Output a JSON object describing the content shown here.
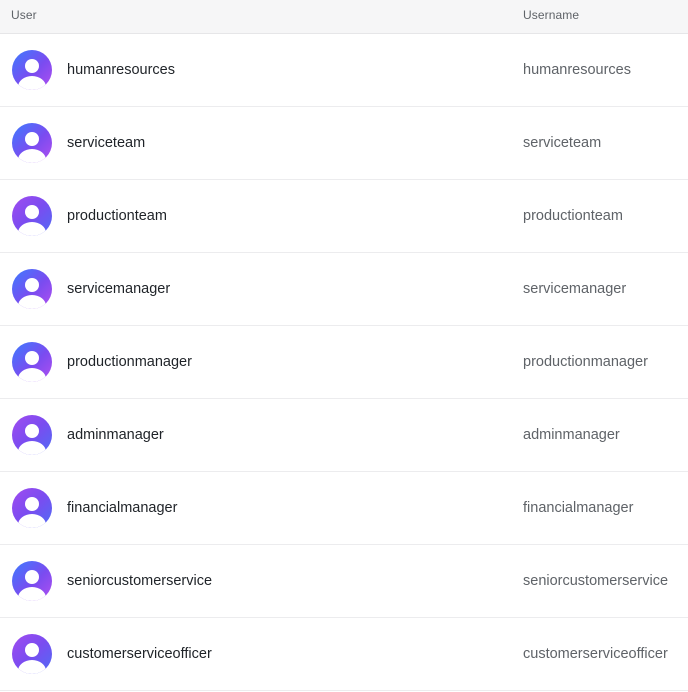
{
  "table": {
    "columns": {
      "user": "User",
      "username": "Username"
    },
    "rows": [
      {
        "name": "humanresources",
        "username": "humanresources",
        "avatar_icon": "user-avatar-icon"
      },
      {
        "name": "serviceteam",
        "username": "serviceteam",
        "avatar_icon": "user-avatar-icon"
      },
      {
        "name": "productionteam",
        "username": "productionteam",
        "avatar_icon": "user-avatar-icon"
      },
      {
        "name": "servicemanager",
        "username": "servicemanager",
        "avatar_icon": "user-avatar-icon"
      },
      {
        "name": "productionmanager",
        "username": "productionmanager",
        "avatar_icon": "user-avatar-icon"
      },
      {
        "name": "adminmanager",
        "username": "adminmanager",
        "avatar_icon": "user-avatar-icon"
      },
      {
        "name": "financialmanager",
        "username": "financialmanager",
        "avatar_icon": "user-avatar-icon"
      },
      {
        "name": "seniorcustomerservice",
        "username": "seniorcustomerservice",
        "avatar_icon": "user-avatar-icon"
      },
      {
        "name": "customerserviceofficer",
        "username": "customerserviceofficer",
        "avatar_icon": "user-avatar-icon"
      }
    ]
  },
  "colors": {
    "header_bg": "#f6f6f7",
    "row_divider": "#ececee",
    "avatar_gradient_blue": "#3d7bff",
    "avatar_gradient_purple": "#b14ff0",
    "name_text": "#1f2328",
    "username_text": "#5f6368"
  }
}
